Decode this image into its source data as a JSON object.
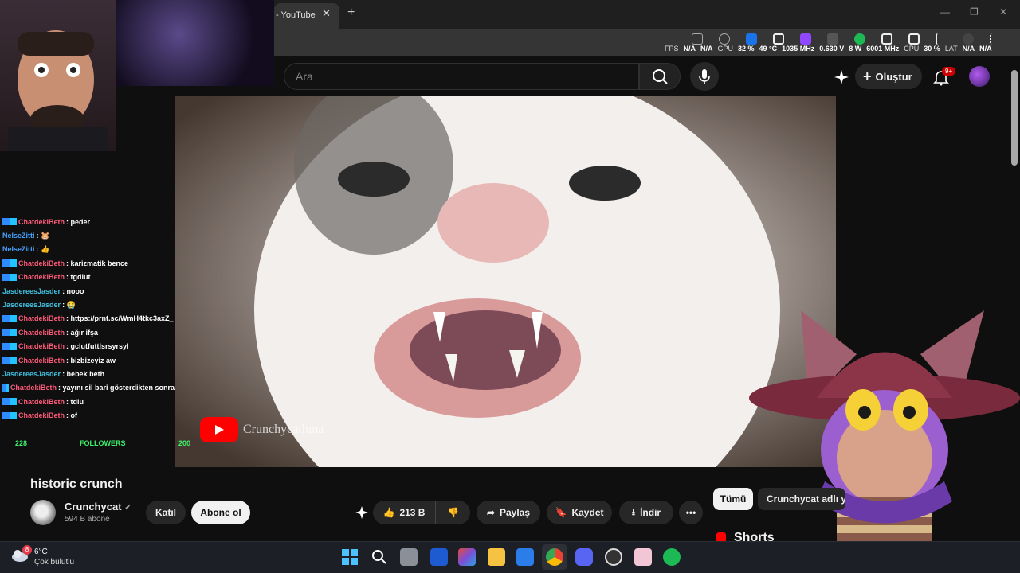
{
  "browser": {
    "tab_title": "- YouTube",
    "tab_close": "✕",
    "new_tab": "+",
    "window_controls": [
      "—",
      "❐",
      "✕"
    ]
  },
  "overlay_stats": {
    "fps_label": "FPS",
    "fps": "N/A",
    "na2": "N/A",
    "gpu_label": "GPU",
    "gpu_load": "32 %",
    "gpu_temp": "49 °C",
    "gpu_clock": "1035 MHz",
    "gpu_volt": "0.630 V",
    "gpu_power": "8 W",
    "mem_clock": "6001 MHz",
    "cpu_label": "CPU",
    "cpu_load": "30 %",
    "lat_label": "LAT",
    "lat": "N/A",
    "lat2": "N/A"
  },
  "youtube": {
    "search_placeholder": "Ara",
    "create_label": "Oluştur",
    "notif_count": "9+",
    "video": {
      "title": "historic crunch",
      "watermark": "Crunchycatluna"
    },
    "channel": {
      "name": "Crunchycat",
      "subs": "594 B abone",
      "join_label": "Katıl",
      "subscribe_label": "Abone ol"
    },
    "actions": {
      "likes": "213 B",
      "share": "Paylaş",
      "save": "Kaydet",
      "download": "İndir",
      "more": "•••"
    },
    "chips": {
      "all": "Tümü",
      "channel": "Crunchycat adlı yi"
    },
    "shorts_label": "Shorts"
  },
  "stream_chat": [
    {
      "user": "ChatdekiBeth",
      "color": "a",
      "badge": true,
      "msg": ": peder"
    },
    {
      "user": "NelseZitti",
      "color": "b",
      "badge": false,
      "msg": ": 🐹"
    },
    {
      "user": "NelseZitti",
      "color": "b",
      "badge": false,
      "msg": ": 👍"
    },
    {
      "user": "ChatdekiBeth",
      "color": "a",
      "badge": true,
      "msg": ": karizmatik bence"
    },
    {
      "user": "ChatdekiBeth",
      "color": "a",
      "badge": true,
      "msg": ": tgdlut"
    },
    {
      "user": "JasdereesJasder",
      "color": "c",
      "badge": false,
      "msg": ": nooo"
    },
    {
      "user": "JasdereesJasder",
      "color": "c",
      "badge": false,
      "msg": ": 😭"
    },
    {
      "user": "ChatdekiBeth",
      "color": "a",
      "badge": true,
      "msg": ": https://prnt.sc/WmH4tkc3axZ_"
    },
    {
      "user": "ChatdekiBeth",
      "color": "a",
      "badge": true,
      "msg": ": ağır ifşa"
    },
    {
      "user": "ChatdekiBeth",
      "color": "a",
      "badge": true,
      "msg": ": gclutfuttlsrsyrsyl"
    },
    {
      "user": "ChatdekiBeth",
      "color": "a",
      "badge": true,
      "msg": ": bizbizeyiz aw"
    },
    {
      "user": "JasdereesJasder",
      "color": "c",
      "badge": false,
      "msg": ": bebek beth"
    },
    {
      "user": "ChatdekiBeth",
      "color": "a",
      "badge": true,
      "msg": ": yayını sil bari gösterdikten sonra"
    },
    {
      "user": "ChatdekiBeth",
      "color": "a",
      "badge": true,
      "msg": ": tdlu"
    },
    {
      "user": "ChatdekiBeth",
      "color": "a",
      "badge": true,
      "msg": ": of"
    }
  ],
  "followers_bar": {
    "current": "228",
    "label": "FOLLOWERS",
    "goal": "200"
  },
  "taskbar": {
    "weather_temp": "6°C",
    "weather_desc": "Çok bulutlu",
    "weather_badge": "8",
    "apps": [
      "start",
      "search",
      "task-view",
      "app-l",
      "office",
      "explorer",
      "store",
      "chrome",
      "discord",
      "obs",
      "app-pink",
      "spotify"
    ]
  }
}
